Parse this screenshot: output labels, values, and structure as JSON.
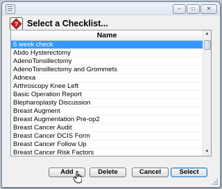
{
  "window": {
    "controls": {
      "minimize": "–",
      "maximize": "□",
      "close": "✕"
    }
  },
  "dialog": {
    "title": "Select a Checklist...",
    "help_icon": "question-mark-icon"
  },
  "list": {
    "column_header": "Name",
    "selected_index": 0,
    "items": [
      "6 week check",
      "Abdo Hysterectomy",
      "AdenoTonsillectomy",
      "AdenoTonsillectomy and Grommets",
      "Adnexa",
      "Arthroscopy Knee Left",
      "Basic Operation Report",
      "Blepharoplasty Discussion",
      "Breast Augment",
      "Breast Augmentation Pre-op2",
      "Breast Cancer Audit",
      "Breast Cancer DCIS Form",
      "Breast Cancer Follow Up",
      "Breast Cancer Risk Factors"
    ]
  },
  "buttons": {
    "add": "Add",
    "delete": "Delete",
    "cancel": "Cancel",
    "select": "Select"
  },
  "colors": {
    "selection": "#3399ff",
    "window_bg": "#f0f0f0"
  }
}
